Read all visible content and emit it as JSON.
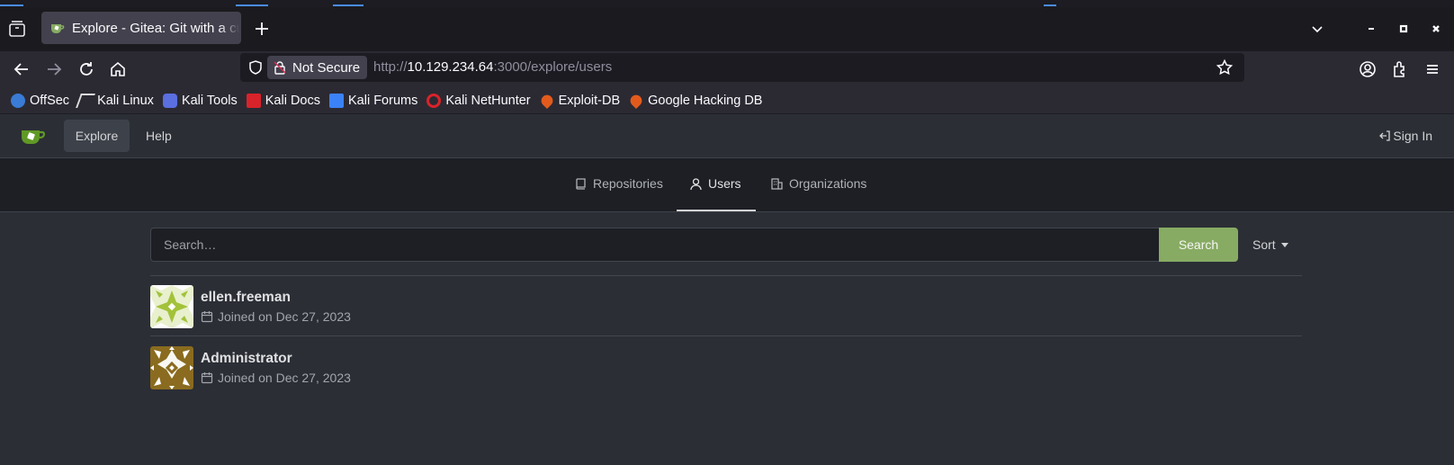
{
  "browser": {
    "tab_title": "Explore - Gitea: Git with a cup of tea",
    "security_label": "Not Secure",
    "url_prefix": "http://",
    "url_host": "10.129.234.64",
    "url_rest": ":3000/explore/users"
  },
  "bookmarks": [
    {
      "label": "OffSec",
      "icon": "offsec-icon",
      "color": "#3a7bd5"
    },
    {
      "label": "Kali Linux",
      "icon": "kali-dragon-icon",
      "color": "#dddddd"
    },
    {
      "label": "Kali Tools",
      "icon": "kali-tools-icon",
      "color": "#5a6fe0"
    },
    {
      "label": "Kali Docs",
      "icon": "kali-docs-icon",
      "color": "#d8232a"
    },
    {
      "label": "Kali Forums",
      "icon": "kali-forums-icon",
      "color": "#3b82f6"
    },
    {
      "label": "Kali NetHunter",
      "icon": "nethunter-icon",
      "color": "#d8232a"
    },
    {
      "label": "Exploit-DB",
      "icon": "exploit-db-icon",
      "color": "#e35b1c"
    },
    {
      "label": "Google Hacking DB",
      "icon": "ghdb-icon",
      "color": "#e35b1c"
    }
  ],
  "gitea": {
    "nav": {
      "explore": "Explore",
      "help": "Help",
      "sign_in": "Sign In"
    },
    "tabs": {
      "repositories": "Repositories",
      "users": "Users",
      "organizations": "Organizations"
    },
    "search": {
      "placeholder": "Search…",
      "button": "Search",
      "sort": "Sort"
    },
    "users": [
      {
        "name": "ellen.freeman",
        "joined": "Joined on Dec 27, 2023",
        "avatar_color": "#a3c23a"
      },
      {
        "name": "Administrator",
        "joined": "Joined on Dec 27, 2023",
        "avatar_color": "#8a6b1f"
      }
    ],
    "accent_green": "#87ab63"
  }
}
